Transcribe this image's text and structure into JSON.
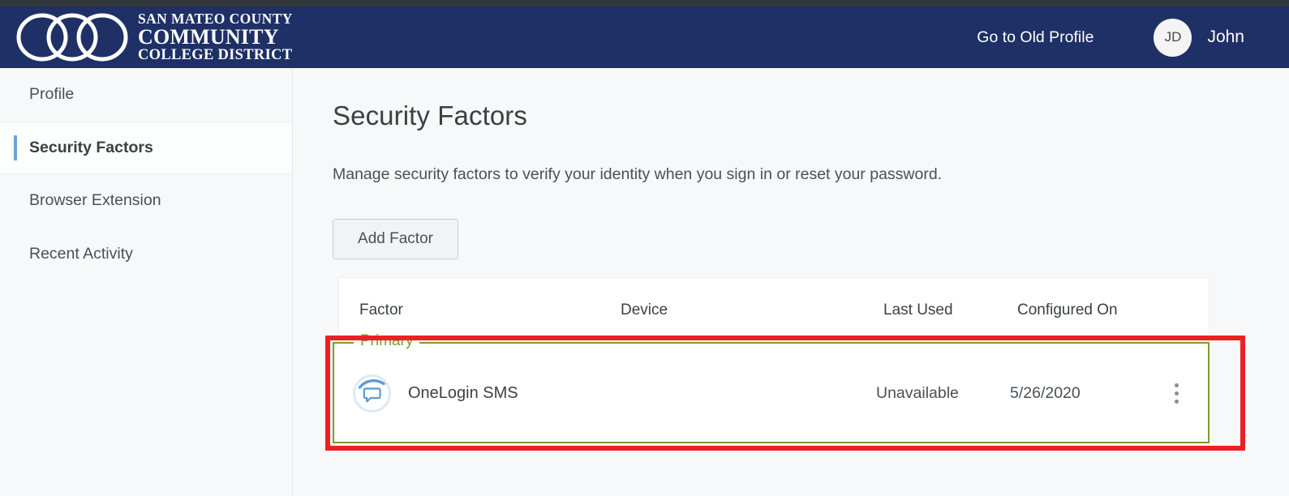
{
  "header": {
    "logo": {
      "line1": "SAN MATEO COUNTY",
      "line2": "COMMUNITY",
      "line3": "COLLEGE DISTRICT",
      "icon": "three-interlocking-rings-logo"
    },
    "old_profile_link": "Go to Old Profile",
    "avatar_initials": "JD",
    "user_name": "John",
    "bg_color": "#1e3066"
  },
  "sidebar": {
    "items": [
      {
        "label": "Profile",
        "active": false
      },
      {
        "label": "Security Factors",
        "active": true
      },
      {
        "label": "Browser Extension",
        "active": false
      },
      {
        "label": "Recent Activity",
        "active": false
      }
    ],
    "active_indicator_color": "#6ba3d8"
  },
  "main": {
    "title": "Security Factors",
    "description": "Manage security factors to verify your identity when you sign in or reset your password.",
    "add_factor_label": "Add Factor",
    "table": {
      "columns": [
        "Factor",
        "Device",
        "Last Used",
        "Configured On"
      ],
      "groups": [
        {
          "legend": "Primary",
          "legend_color": "#7d9c2c",
          "highlight_color": "#ed2024",
          "rows": [
            {
              "icon": "sms-speech-bubble-icon",
              "factor": "OneLogin SMS",
              "device": "",
              "last_used": "Unavailable",
              "configured_on": "5/26/2020",
              "menu_icon": "kebab-menu-icon"
            }
          ]
        }
      ]
    }
  }
}
